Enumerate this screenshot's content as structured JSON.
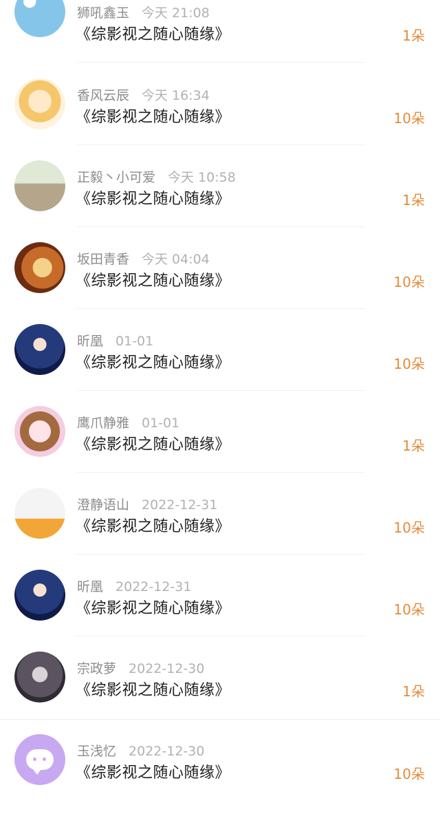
{
  "gifts": [
    {
      "name": "狮吼鑫玉",
      "time": "今天 21:08",
      "title": "《综影视之随心随缘》",
      "amount": "1朵",
      "avatar_icon": "rainbow-fan-avatar"
    },
    {
      "name": "香风云辰",
      "time": "今天 16:34",
      "title": "《综影视之随心随缘》",
      "amount": "10朵",
      "avatar_icon": "anime-girl-avatar"
    },
    {
      "name": "正毅丶小可爱",
      "time": "今天 10:58",
      "title": "《综影视之随心随缘》",
      "amount": "1朵",
      "avatar_icon": "alpaca-avatar"
    },
    {
      "name": "坂田青香",
      "time": "今天 04:04",
      "title": "《综影视之随心随缘》",
      "amount": "10朵",
      "avatar_icon": "cartoon-avatar"
    },
    {
      "name": "昕凰",
      "time": "01-01",
      "title": "《综影视之随心随缘》",
      "amount": "10朵",
      "avatar_icon": "anime-girl-blue-avatar"
    },
    {
      "name": "鹰爪静雅",
      "time": "01-01",
      "title": "《综影视之随心随缘》",
      "amount": "1朵",
      "avatar_icon": "chibi-girl-avatar"
    },
    {
      "name": "澄静语山",
      "time": "2022-12-31",
      "title": "《综影视之随心随缘》",
      "amount": "10朵",
      "avatar_icon": "couple-photo-avatar"
    },
    {
      "name": "昕凰",
      "time": "2022-12-31",
      "title": "《综影视之随心随缘》",
      "amount": "10朵",
      "avatar_icon": "anime-girl-blue-avatar"
    },
    {
      "name": "宗政萝",
      "time": "2022-12-30",
      "title": "《综影视之随心随缘》",
      "amount": "1朵",
      "avatar_icon": "portrait-avatar"
    },
    {
      "name": "玉浅忆",
      "time": "2022-12-30",
      "title": "《综影视之随心随缘》",
      "amount": "10朵",
      "avatar_icon": "chat-bubble-avatar"
    }
  ]
}
